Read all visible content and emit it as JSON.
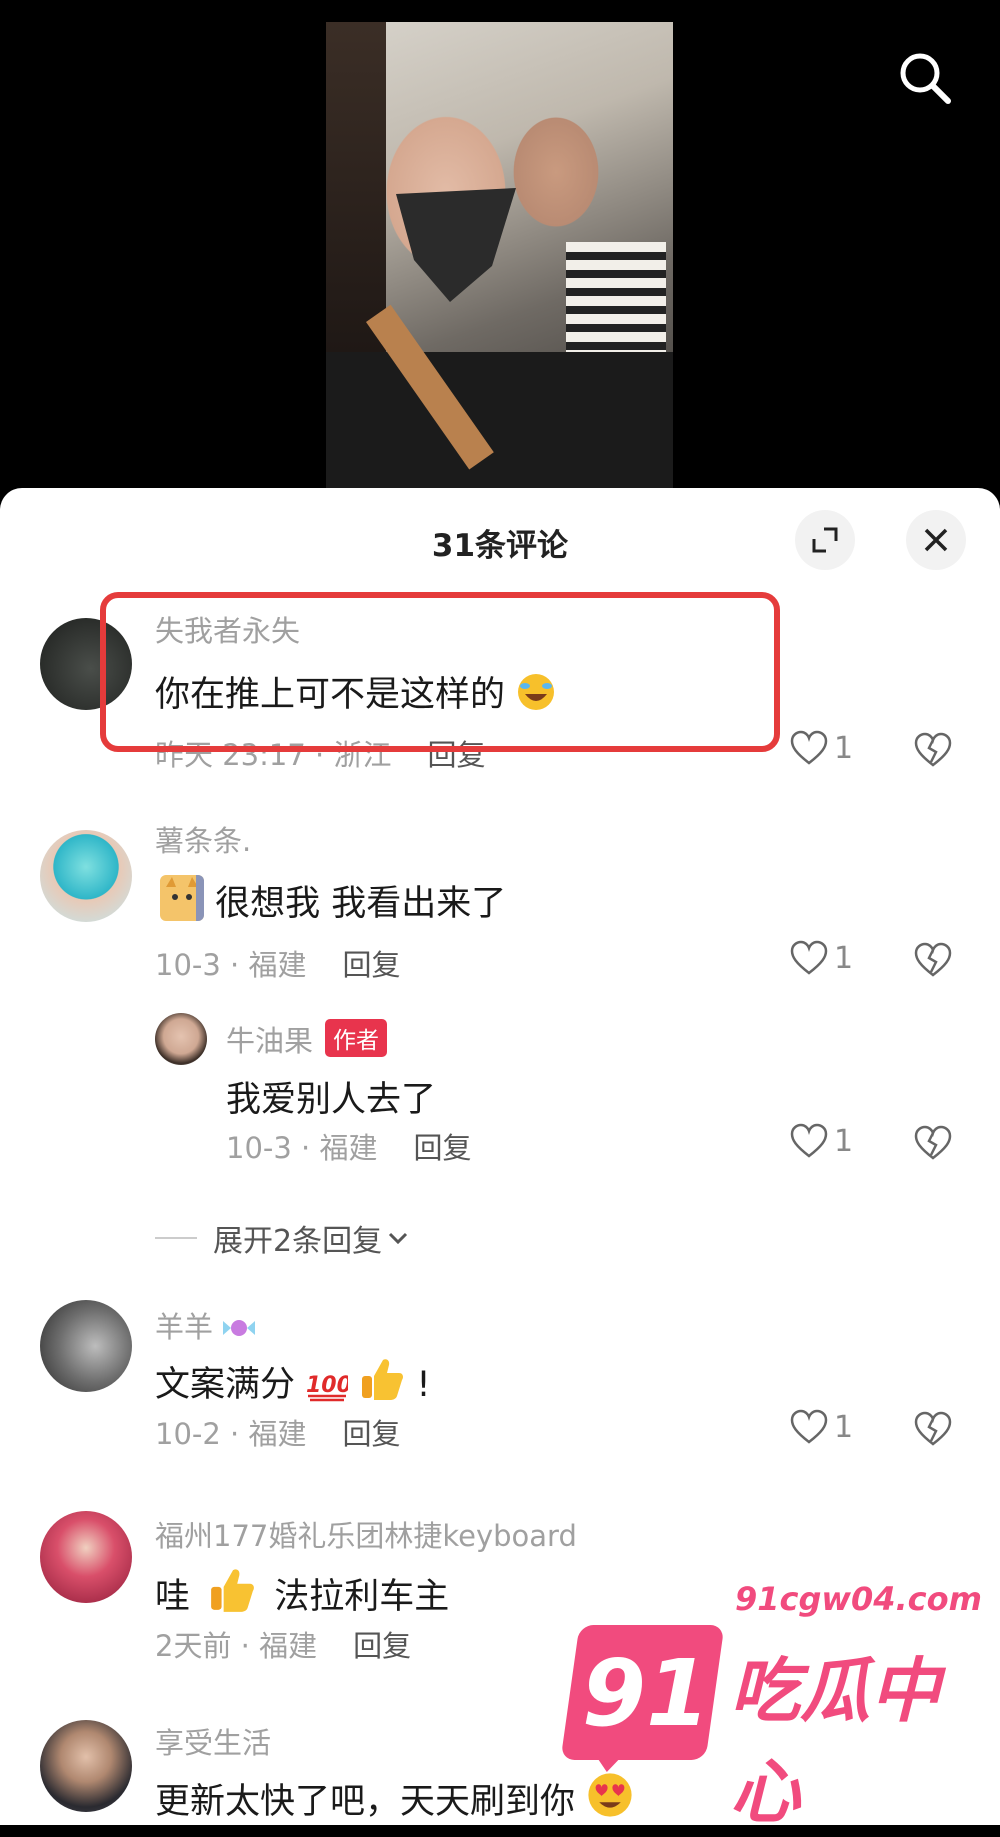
{
  "sheet": {
    "title": "31条评论"
  },
  "comments": [
    {
      "username": "失我者永失",
      "content": "你在推上可不是这样的",
      "meta": "昨天 23:17 · 浙江",
      "reply": "回复",
      "likes": "1"
    },
    {
      "username": "薯条条.",
      "content": "很想我 我看出来了",
      "meta": "10-3 · 福建",
      "reply": "回复",
      "likes": "1",
      "reply_item": {
        "username": "牛油果",
        "badge": "作者",
        "content": "我爱别人去了",
        "meta": "10-3 · 福建",
        "reply": "回复",
        "likes": "1"
      }
    },
    {
      "username": "羊羊",
      "content": "文案满分",
      "suffix": "!",
      "meta": "10-2 · 福建",
      "reply": "回复",
      "likes": "1"
    },
    {
      "username": "福州177婚礼乐团林捷keyboard",
      "content_a": "哇",
      "content_b": "法拉利车主",
      "meta": "2天前 · 福建",
      "reply": "回复"
    },
    {
      "username": "享受生活",
      "content": "更新太快了吧，天天刷到你"
    }
  ],
  "expand_replies": "展开2条回复",
  "watermark": {
    "number": "91",
    "url": "91cgw04.com",
    "name": "吃瓜中心"
  },
  "icons": {
    "search": "search-icon",
    "expand": "expand-icon",
    "close": "close-icon",
    "like": "heart-outline-icon",
    "dislike": "broken-heart-icon",
    "chevron": "chevron-down-icon"
  },
  "colors": {
    "highlight": "#e53b3b",
    "author_badge": "#e8344d",
    "watermark": "#f14b7e"
  }
}
